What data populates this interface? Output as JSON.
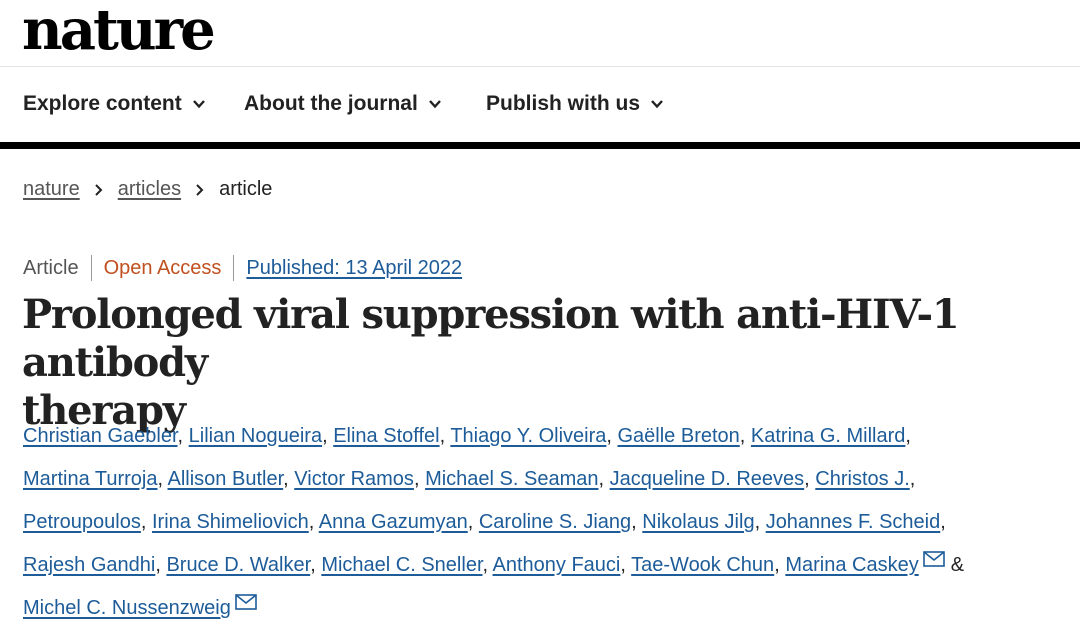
{
  "header": {
    "logo": "nature"
  },
  "nav": {
    "items": [
      {
        "label": "Explore content"
      },
      {
        "label": "About the journal"
      },
      {
        "label": "Publish with us"
      }
    ]
  },
  "breadcrumb": {
    "items": [
      "nature",
      "articles"
    ],
    "current": "article"
  },
  "meta": {
    "type": "Article",
    "access": "Open Access",
    "published": "Published: 13 April 2022"
  },
  "article": {
    "title_line1": "Prolonged viral suppression with anti-HIV-1 antibody",
    "title_line2": "therapy"
  },
  "authors": [
    "Christian Gaebler",
    "Lilian Nogueira",
    "Elina Stoffel",
    "Thiago Y. Oliveira",
    "Gaëlle Breton",
    "Katrina G. Millard",
    "Martina Turroja",
    "Allison Butler",
    "Victor Ramos",
    "Michael S. Seaman",
    "Jacqueline D. Reeves",
    "Christos J.",
    "Petroupoulos",
    "Irina Shimeliovich",
    "Anna Gazumyan",
    "Caroline S. Jiang",
    "Nikolaus Jilg",
    "Johannes F. Scheid",
    "Rajesh Gandhi",
    "Bruce D. Walker",
    "Michael C. Sneller",
    "Anthony Fauci",
    "Tae-Wook Chun",
    "Marina Caskey",
    "Michel C. Nussenzweig"
  ],
  "authors_separator": ",",
  "authors_ampersand": "&",
  "colors": {
    "link": "#1d5c99",
    "open_access": "#c0501f",
    "text": "#222222",
    "muted": "#555555"
  },
  "icons": {
    "nav_dropdown": "chevron-down-icon",
    "breadcrumb_separator": "chevron-right-icon",
    "author_contact": "mail-icon"
  }
}
